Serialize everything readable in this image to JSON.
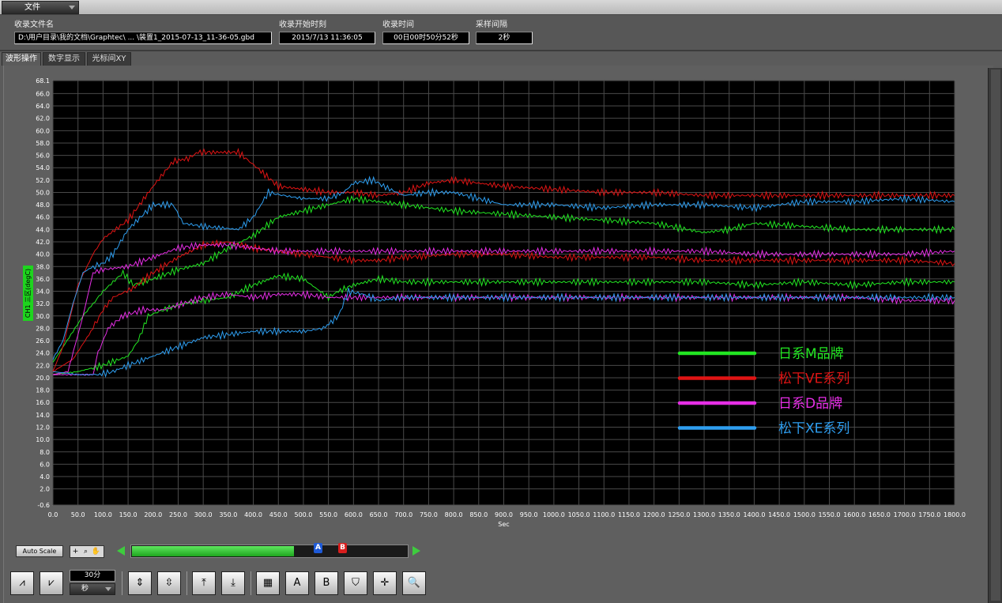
{
  "menu": {
    "file_label": "文件"
  },
  "info": {
    "file_name_label": "收录文件名",
    "file_name_value": "D:\\用户目录\\我的文档\\Graphtec\\ ... \\装置1_2015-07-13_11-36-05.gbd",
    "start_label": "收录开始时刻",
    "start_value": "2015/7/13 11:36:05",
    "duration_label": "收录时间",
    "duration_value": "00日00时50分52秒",
    "interval_label": "采样间隔",
    "interval_value": "2秒"
  },
  "tabs": [
    "波形操作",
    "数字显示",
    "光标间XY"
  ],
  "y_axis_label": "CH1 三区(degC)",
  "controls": {
    "auto_scale": "Auto Scale",
    "cursor_a": "A",
    "cursor_b": "B",
    "time_value": "30分",
    "time_unit": "秒",
    "slider_fraction": 0.59
  },
  "colors": {
    "green": "#22e622",
    "red": "#e01414",
    "magenta": "#e62ee6",
    "blue": "#2e9ef0"
  },
  "chart_data": {
    "type": "line",
    "xlabel": "Sec",
    "ylabel": "CH1 三区(degC)",
    "xlim": [
      0,
      1800
    ],
    "ylim": [
      -0.6,
      68.1
    ],
    "grid": true,
    "legend_position": "bottom-right",
    "x_ticks": [
      "0.0",
      "50.0",
      "100.0",
      "150.0",
      "200.0",
      "250.0",
      "300.0",
      "350.0",
      "400.0",
      "450.0",
      "500.0",
      "550.0",
      "600.0",
      "650.0",
      "700.0",
      "750.0",
      "800.0",
      "850.0",
      "900.0",
      "950.0",
      "1000.0",
      "1050.0",
      "1100.0",
      "1150.0",
      "1200.0",
      "1250.0",
      "1300.0",
      "1350.0",
      "1400.0",
      "1450.0",
      "1500.0",
      "1550.0",
      "1600.0",
      "1650.0",
      "1700.0",
      "1750.0",
      "1800.0"
    ],
    "y_ticks": [
      "-0.6",
      "2.0",
      "4.0",
      "6.0",
      "8.0",
      "10.0",
      "12.0",
      "14.0",
      "16.0",
      "18.0",
      "20.0",
      "22.0",
      "24.0",
      "26.0",
      "28.0",
      "30.0",
      "32.0",
      "34.0",
      "36.0",
      "38.0",
      "40.0",
      "42.0",
      "44.0",
      "46.0",
      "48.0",
      "50.0",
      "52.0",
      "54.0",
      "56.0",
      "58.0",
      "60.0",
      "62.0",
      "64.0",
      "66.0",
      "68.1"
    ],
    "series": [
      {
        "name": "日系M品牌",
        "color": "#22e622",
        "points": [
          [
            0,
            22.5
          ],
          [
            20,
            25
          ],
          [
            60,
            30
          ],
          [
            100,
            34
          ],
          [
            140,
            37
          ],
          [
            160,
            35
          ],
          [
            200,
            36
          ],
          [
            250,
            37.5
          ],
          [
            300,
            38.5
          ],
          [
            350,
            41
          ],
          [
            400,
            43
          ],
          [
            450,
            46
          ],
          [
            500,
            47
          ],
          [
            550,
            48
          ],
          [
            600,
            49
          ],
          [
            650,
            48.5
          ],
          [
            700,
            48
          ],
          [
            800,
            47
          ],
          [
            900,
            46.5
          ],
          [
            1000,
            46
          ],
          [
            1100,
            45.5
          ],
          [
            1200,
            45
          ],
          [
            1300,
            43.5
          ],
          [
            1350,
            44
          ],
          [
            1400,
            45
          ],
          [
            1500,
            44.5
          ],
          [
            1600,
            44
          ],
          [
            1700,
            44
          ],
          [
            1800,
            44
          ]
        ]
      },
      {
        "name": "日系M品牌",
        "color": "#22e622",
        "points": [
          [
            0,
            20.5
          ],
          [
            50,
            21
          ],
          [
            100,
            22
          ],
          [
            150,
            23.5
          ],
          [
            170,
            26
          ],
          [
            190,
            30
          ],
          [
            220,
            31
          ],
          [
            260,
            32
          ],
          [
            300,
            32.5
          ],
          [
            350,
            33
          ],
          [
            400,
            35
          ],
          [
            450,
            36.5
          ],
          [
            500,
            36
          ],
          [
            550,
            33
          ],
          [
            570,
            34
          ],
          [
            600,
            35
          ],
          [
            650,
            36
          ],
          [
            700,
            35.5
          ],
          [
            800,
            35.5
          ],
          [
            900,
            35.5
          ],
          [
            1000,
            35.5
          ],
          [
            1100,
            35.5
          ],
          [
            1200,
            35.5
          ],
          [
            1300,
            35.5
          ],
          [
            1400,
            35
          ],
          [
            1500,
            35.5
          ],
          [
            1600,
            35
          ],
          [
            1700,
            35.5
          ],
          [
            1800,
            35.5
          ]
        ]
      },
      {
        "name": "松下VE系列",
        "color": "#e01414",
        "points": [
          [
            0,
            21
          ],
          [
            20,
            25
          ],
          [
            50,
            35
          ],
          [
            80,
            40
          ],
          [
            100,
            42.5
          ],
          [
            150,
            45.5
          ],
          [
            200,
            51
          ],
          [
            240,
            55
          ],
          [
            270,
            55.5
          ],
          [
            290,
            56.5
          ],
          [
            320,
            56.5
          ],
          [
            370,
            56.5
          ],
          [
            400,
            54.5
          ],
          [
            450,
            51
          ],
          [
            500,
            50.5
          ],
          [
            550,
            50
          ],
          [
            600,
            50
          ],
          [
            650,
            49.5
          ],
          [
            700,
            50
          ],
          [
            750,
            51.5
          ],
          [
            800,
            52
          ],
          [
            850,
            51.5
          ],
          [
            900,
            51
          ],
          [
            1000,
            50.5
          ],
          [
            1100,
            50
          ],
          [
            1200,
            50
          ],
          [
            1300,
            49.5
          ],
          [
            1400,
            49.5
          ],
          [
            1500,
            49.5
          ],
          [
            1600,
            49.5
          ],
          [
            1700,
            49.5
          ],
          [
            1800,
            49.5
          ]
        ]
      },
      {
        "name": "松下VE系列",
        "color": "#e01414",
        "points": [
          [
            0,
            21
          ],
          [
            40,
            23
          ],
          [
            80,
            28
          ],
          [
            100,
            31
          ],
          [
            120,
            33
          ],
          [
            160,
            34.5
          ],
          [
            200,
            37
          ],
          [
            250,
            39.5
          ],
          [
            300,
            41.5
          ],
          [
            350,
            42
          ],
          [
            400,
            41
          ],
          [
            450,
            40.5
          ],
          [
            500,
            40
          ],
          [
            550,
            39.5
          ],
          [
            600,
            39
          ],
          [
            650,
            39
          ],
          [
            700,
            39.5
          ],
          [
            800,
            40
          ],
          [
            900,
            40
          ],
          [
            1000,
            39.5
          ],
          [
            1100,
            39.5
          ],
          [
            1200,
            39.5
          ],
          [
            1300,
            39
          ],
          [
            1400,
            39
          ],
          [
            1500,
            39
          ],
          [
            1600,
            39
          ],
          [
            1700,
            39
          ],
          [
            1800,
            38.5
          ]
        ]
      },
      {
        "name": "日系D品牌",
        "color": "#e62ee6",
        "points": [
          [
            0,
            20.5
          ],
          [
            30,
            21
          ],
          [
            60,
            30
          ],
          [
            80,
            37
          ],
          [
            100,
            37.5
          ],
          [
            150,
            38
          ],
          [
            200,
            39.5
          ],
          [
            250,
            41
          ],
          [
            300,
            41.5
          ],
          [
            350,
            41.5
          ],
          [
            400,
            41
          ],
          [
            450,
            40.5
          ],
          [
            500,
            40.5
          ],
          [
            600,
            40.5
          ],
          [
            700,
            40.5
          ],
          [
            800,
            40.5
          ],
          [
            900,
            40.5
          ],
          [
            1000,
            40.5
          ],
          [
            1100,
            40.5
          ],
          [
            1200,
            40.5
          ],
          [
            1300,
            40.5
          ],
          [
            1400,
            40
          ],
          [
            1500,
            40
          ],
          [
            1600,
            40
          ],
          [
            1700,
            40
          ],
          [
            1800,
            40.5
          ]
        ]
      },
      {
        "name": "日系D品牌",
        "color": "#e62ee6",
        "points": [
          [
            0,
            20.5
          ],
          [
            80,
            20.5
          ],
          [
            90,
            24
          ],
          [
            110,
            28
          ],
          [
            140,
            30
          ],
          [
            180,
            31
          ],
          [
            220,
            31
          ],
          [
            260,
            32
          ],
          [
            300,
            33
          ],
          [
            350,
            33.5
          ],
          [
            400,
            33
          ],
          [
            450,
            33.5
          ],
          [
            500,
            33.5
          ],
          [
            550,
            33
          ],
          [
            600,
            33
          ],
          [
            700,
            33
          ],
          [
            800,
            33
          ],
          [
            900,
            33
          ],
          [
            1000,
            33
          ],
          [
            1100,
            33
          ],
          [
            1200,
            33
          ],
          [
            1300,
            33
          ],
          [
            1400,
            33
          ],
          [
            1500,
            33
          ],
          [
            1600,
            33
          ],
          [
            1700,
            32.5
          ],
          [
            1800,
            32.5
          ]
        ]
      },
      {
        "name": "松下XE系列",
        "color": "#2e9ef0",
        "points": [
          [
            0,
            23
          ],
          [
            20,
            26
          ],
          [
            40,
            32
          ],
          [
            60,
            37
          ],
          [
            80,
            38
          ],
          [
            100,
            38.5
          ],
          [
            120,
            40
          ],
          [
            150,
            44
          ],
          [
            200,
            48
          ],
          [
            240,
            48
          ],
          [
            260,
            45
          ],
          [
            300,
            44.5
          ],
          [
            370,
            44
          ],
          [
            400,
            46
          ],
          [
            430,
            50
          ],
          [
            460,
            49.5
          ],
          [
            500,
            49
          ],
          [
            550,
            49
          ],
          [
            580,
            50
          ],
          [
            600,
            51.5
          ],
          [
            640,
            52
          ],
          [
            660,
            51
          ],
          [
            700,
            49.5
          ],
          [
            750,
            50
          ],
          [
            800,
            50
          ],
          [
            850,
            49
          ],
          [
            900,
            48
          ],
          [
            1000,
            48
          ],
          [
            1100,
            47.5
          ],
          [
            1200,
            48
          ],
          [
            1300,
            48
          ],
          [
            1400,
            47.5
          ],
          [
            1500,
            48.5
          ],
          [
            1600,
            48.5
          ],
          [
            1700,
            49
          ],
          [
            1800,
            48.5
          ]
        ]
      },
      {
        "name": "松下XE系列",
        "color": "#2e9ef0",
        "points": [
          [
            0,
            21
          ],
          [
            50,
            20.5
          ],
          [
            90,
            20.5
          ],
          [
            120,
            21
          ],
          [
            150,
            22
          ],
          [
            200,
            23.5
          ],
          [
            250,
            25
          ],
          [
            300,
            26.5
          ],
          [
            350,
            27
          ],
          [
            400,
            27.5
          ],
          [
            450,
            27.5
          ],
          [
            500,
            27.5
          ],
          [
            540,
            28
          ],
          [
            570,
            30
          ],
          [
            590,
            34
          ],
          [
            620,
            33.5
          ],
          [
            650,
            32.5
          ],
          [
            700,
            33
          ],
          [
            800,
            33
          ],
          [
            900,
            33
          ],
          [
            1000,
            33
          ],
          [
            1100,
            33
          ],
          [
            1200,
            33
          ],
          [
            1300,
            33
          ],
          [
            1400,
            33
          ],
          [
            1500,
            33
          ],
          [
            1600,
            33
          ],
          [
            1700,
            33
          ],
          [
            1800,
            33
          ]
        ]
      }
    ],
    "legend": [
      {
        "label": "日系M品牌",
        "color": "#22e622"
      },
      {
        "label": "松下VE系列",
        "color": "#e01414"
      },
      {
        "label": "日系D品牌",
        "color": "#e62ee6"
      },
      {
        "label": "松下XE系列",
        "color": "#2e9ef0"
      }
    ]
  }
}
